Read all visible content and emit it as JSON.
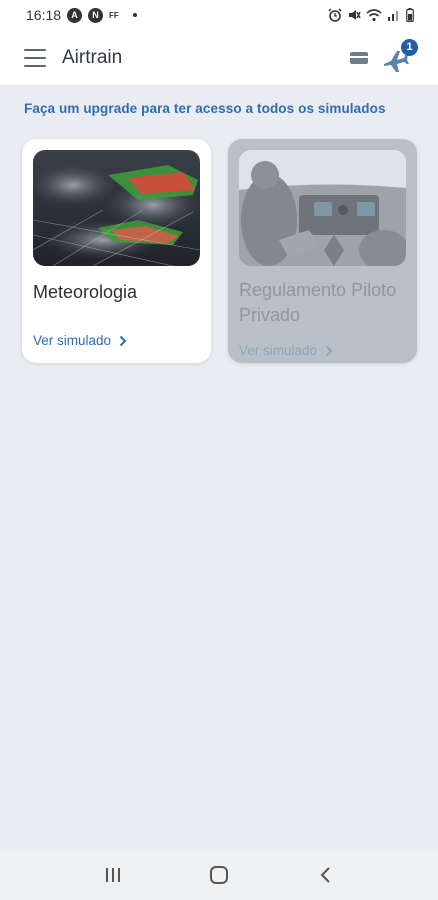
{
  "status_bar": {
    "time": "16:18",
    "icons": [
      "a-circle-icon",
      "n-circle-icon",
      "ff-icon",
      "dot-icon",
      "alarm-icon",
      "mute-icon",
      "wifi-icon",
      "signal-icon",
      "battery-icon"
    ],
    "badge_a": "A",
    "badge_n": "N",
    "ff": "FF"
  },
  "app_bar": {
    "title": "Airtrain",
    "notification_count": "1"
  },
  "promo_text": "Faça um upgrade para ter acesso a todos os simulados",
  "cards": [
    {
      "title": "Meteorologia",
      "link": "Ver simulado",
      "locked": false
    },
    {
      "title": "Regulamento Piloto Privado",
      "link": "Ver simulado",
      "locked": true
    }
  ],
  "colors": {
    "accent": "#2f6cb3",
    "background": "#e9edf1",
    "badge": "#1f5fa8"
  }
}
